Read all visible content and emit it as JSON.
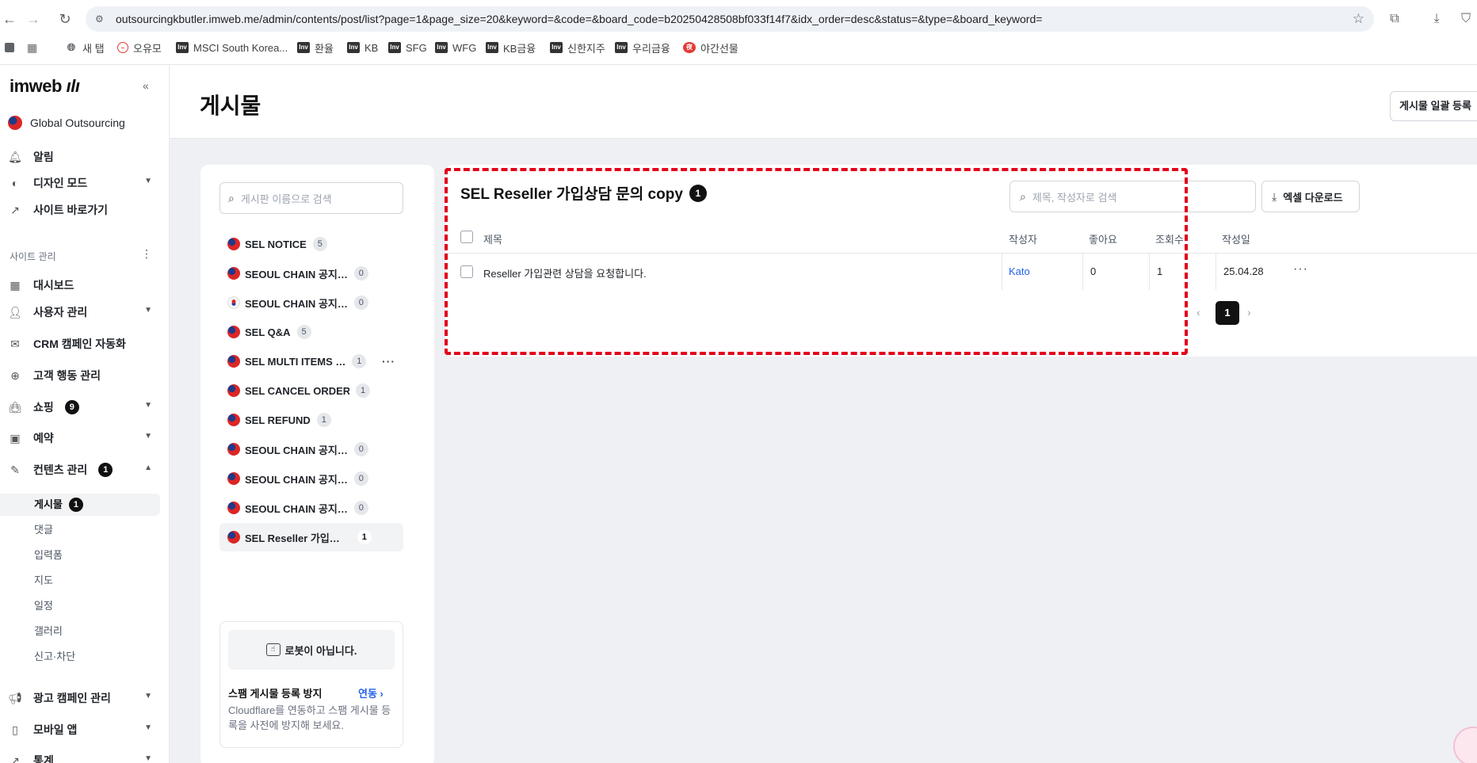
{
  "browser": {
    "url": "outsourcingkbutler.imweb.me/admin/contents/post/list?page=1&page_size=20&keyword=&code=&board_code=b20250428508bf033f14f7&idx_order=desc&status=&type=&board_keyword=",
    "bookmarks": [
      {
        "label": "새 탭",
        "icon": "globe-icon"
      },
      {
        "label": "오유모",
        "icon": "circle-icon"
      },
      {
        "label": "MSCI South Korea...",
        "icon": "inv-icon"
      },
      {
        "label": "환율",
        "icon": "inv-icon"
      },
      {
        "label": "KB",
        "icon": "inv-icon"
      },
      {
        "label": "SFG",
        "icon": "inv-icon"
      },
      {
        "label": "WFG",
        "icon": "inv-icon"
      },
      {
        "label": "KB금융",
        "icon": "inv-icon"
      },
      {
        "label": "신한지주",
        "icon": "inv-icon"
      },
      {
        "label": "우리금융",
        "icon": "inv-icon"
      },
      {
        "label": "야간선물",
        "icon": "night-icon"
      }
    ]
  },
  "sidebar": {
    "logo": "imweb",
    "site_name": "Global Outsourcing",
    "top_items": [
      {
        "label": "알림",
        "icon": "bell-icon"
      },
      {
        "label": "디자인 모드",
        "icon": "palette-icon",
        "expandable": true
      },
      {
        "label": "사이트 바로가기",
        "icon": "external-link-icon"
      }
    ],
    "section_label": "사이트 관리",
    "items": [
      {
        "label": "대시보드",
        "icon": "dashboard-icon"
      },
      {
        "label": "사용자 관리",
        "icon": "user-icon",
        "expandable": true
      },
      {
        "label": "CRM 캠페인 자동화",
        "icon": "mail-icon"
      },
      {
        "label": "고객 행동 관리",
        "icon": "target-icon"
      },
      {
        "label": "쇼핑",
        "icon": "bag-icon",
        "badge": "9",
        "expandable": true
      },
      {
        "label": "예약",
        "icon": "calendar-icon",
        "expandable": true
      },
      {
        "label": "컨텐츠 관리",
        "icon": "edit-icon",
        "badge": "1",
        "expanded": true
      }
    ],
    "sub_items": [
      {
        "label": "게시물",
        "badge": "1",
        "active": true
      },
      {
        "label": "댓글"
      },
      {
        "label": "입력폼"
      },
      {
        "label": "지도"
      },
      {
        "label": "일정"
      },
      {
        "label": "갤러리"
      },
      {
        "label": "신고·차단"
      }
    ],
    "bottom_items": [
      {
        "label": "광고 캠페인 관리",
        "icon": "megaphone-icon"
      },
      {
        "label": "모바일 앱",
        "icon": "mobile-icon"
      },
      {
        "label": "통계",
        "icon": "chart-icon"
      }
    ]
  },
  "header": {
    "title": "게시물",
    "bulk_button": "게시물 일괄 등록"
  },
  "boards": {
    "search_placeholder": "게시판 이름으로 검색",
    "items": [
      {
        "name": "SEL NOTICE",
        "count": "5",
        "flag": "tw"
      },
      {
        "name": "SEOUL CHAIN 공지…",
        "count": "0",
        "flag": "tw"
      },
      {
        "name": "SEOUL CHAIN 공지…",
        "count": "0",
        "flag": "kr"
      },
      {
        "name": "SEL Q&A",
        "count": "5",
        "flag": "tw"
      },
      {
        "name": "SEL MULTI ITEMS …",
        "count": "1",
        "flag": "tw",
        "more": true
      },
      {
        "name": "SEL CANCEL ORDER",
        "count": "1",
        "flag": "tw"
      },
      {
        "name": "SEL REFUND",
        "count": "1",
        "flag": "tw"
      },
      {
        "name": "SEOUL CHAIN 공지…",
        "count": "0",
        "flag": "tw"
      },
      {
        "name": "SEOUL CHAIN 공지…",
        "count": "0",
        "flag": "tw"
      },
      {
        "name": "SEOUL CHAIN 공지…",
        "count": "0",
        "flag": "tw"
      },
      {
        "name": "SEL Reseller 가입…",
        "count": "1",
        "flag": "tw",
        "active": true
      }
    ],
    "spam": {
      "robot_label": "로봇이 아닙니다.",
      "title": "스팸 게시물 등록 방지",
      "link": "연동",
      "description": "Cloudflare를 연동하고 스팸 게시물 등록을 사전에 방지해 보세요."
    }
  },
  "posts": {
    "board_title": "SEL Reseller 가입상담 문의 copy",
    "count": "1",
    "search_placeholder": "제목, 작성자로 검색",
    "excel_button": "엑셀 다운로드",
    "columns": {
      "title": "제목",
      "author": "작성자",
      "likes": "좋아요",
      "views": "조회수",
      "date": "작성일"
    },
    "rows": [
      {
        "title": "Reseller 가입관련 상담을 요청합니다.",
        "author": "Kato",
        "likes": "0",
        "views": "1",
        "date": "25.04.28"
      }
    ],
    "pagination": {
      "current": "1"
    }
  },
  "colors": {
    "accent": "#2563eb",
    "highlight": "#e3001b",
    "badge": "#111111"
  }
}
